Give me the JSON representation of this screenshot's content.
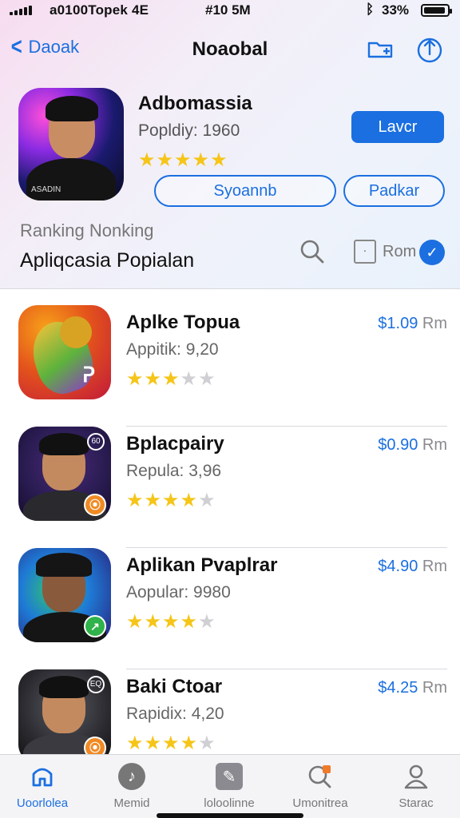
{
  "status_bar": {
    "carrier": "a0100Topek 4E",
    "time": "#10 5M",
    "battery_percent": "33%",
    "bluetooth_icon": "bluetooth-icon",
    "battery_level": 0.85
  },
  "nav": {
    "back_label": "Daoak",
    "title": "Noaobal",
    "icons": [
      "folder-icon",
      "share-icon"
    ]
  },
  "featured": {
    "name": "Adbomassia",
    "popularity": "Popldiy: 1960",
    "rating": 4.5,
    "stars": "★★★★★",
    "primary_button": "Lavcr",
    "secondary_button_1": "Syoannb",
    "secondary_button_2": "Padkar",
    "icon_tag": "ASADIN"
  },
  "section": {
    "subtitle": "Ranking Nonking",
    "title": "Apliqcasia Popialan",
    "filter_label": "Rom",
    "filter_box_char": "·",
    "check_glyph": "✓"
  },
  "apps": [
    {
      "name": "Aplke Topua",
      "sub": "Appitik: 9,20",
      "stars_on": "★★★",
      "stars_off": "★★",
      "rating": 3.5,
      "price": "$1.09",
      "price_unit": "Rm",
      "icon_glyph": "ᕈ"
    },
    {
      "name": "Bplacpairy",
      "sub": "Repula: 3,96",
      "stars_on": "★★★★",
      "stars_off": "★",
      "rating": 4,
      "price": "$0.90",
      "price_unit": "Rm",
      "badge_glyph": "⦿",
      "top_badge": "60"
    },
    {
      "name": "Aplikan Pvaplrar",
      "sub": "Aopular: 9980",
      "stars_on": "★★★★",
      "stars_off": "★",
      "rating": 4,
      "price": "$4.90",
      "price_unit": "Rm",
      "badge_glyph": "↗"
    },
    {
      "name": "Baki Ctoar",
      "sub": "Rapidix: 4,20",
      "stars_on": "★★★★",
      "stars_off": "★",
      "rating": 4,
      "price": "$4.25",
      "price_unit": "Rm",
      "badge_glyph": "⦿",
      "top_badge": "EQ"
    }
  ],
  "tabs": [
    {
      "label": "Uoorlolea",
      "icon": "home-icon",
      "active": true
    },
    {
      "label": "Memid",
      "icon": "music-note-icon",
      "active": false
    },
    {
      "label": "loloolinne",
      "icon": "pen-icon",
      "active": false
    },
    {
      "label": "Umonitrea",
      "icon": "search-icon",
      "active": false
    },
    {
      "label": "Starac",
      "icon": "person-icon",
      "active": false
    }
  ],
  "colors": {
    "accent": "#1b6fe0",
    "star": "#f5c518"
  }
}
